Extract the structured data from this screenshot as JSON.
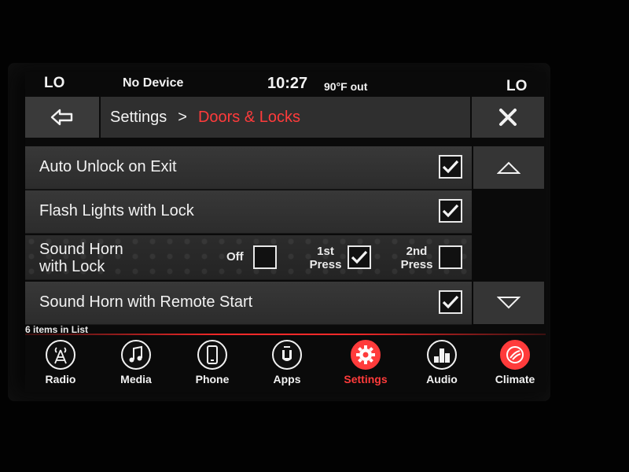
{
  "status": {
    "left_temp": "LO",
    "device": "No Device",
    "time": "10:27",
    "outside_temp": "90°F out",
    "right_temp": "LO"
  },
  "header": {
    "back_icon": "arrow-left-icon",
    "breadcrumb_parent": "Settings",
    "breadcrumb_separator": ">",
    "breadcrumb_current": "Doors & Locks",
    "close_icon": "close-icon"
  },
  "settings": {
    "auto_unlock": {
      "label": "Auto Unlock on Exit",
      "checked": true
    },
    "flash_lights": {
      "label": "Flash Lights with Lock",
      "checked": true
    },
    "sound_horn": {
      "label_line1": "Sound Horn",
      "label_line2": "with Lock",
      "options": {
        "off": {
          "label": "Off",
          "checked": false
        },
        "first": {
          "label_line1": "1st",
          "label_line2": "Press",
          "checked": true
        },
        "second": {
          "label_line1": "2nd",
          "label_line2": "Press",
          "checked": false
        }
      }
    },
    "remote_start": {
      "label": "Sound Horn with Remote Start",
      "checked": true
    }
  },
  "list_count": "6 items in List",
  "nav": {
    "radio": "Radio",
    "media": "Media",
    "phone": "Phone",
    "apps": "Apps",
    "settings": "Settings",
    "audio": "Audio",
    "climate": "Climate"
  },
  "colors": {
    "accent": "#ff3b3b",
    "row_bg": "#333333",
    "text": "#f2f2f2"
  }
}
